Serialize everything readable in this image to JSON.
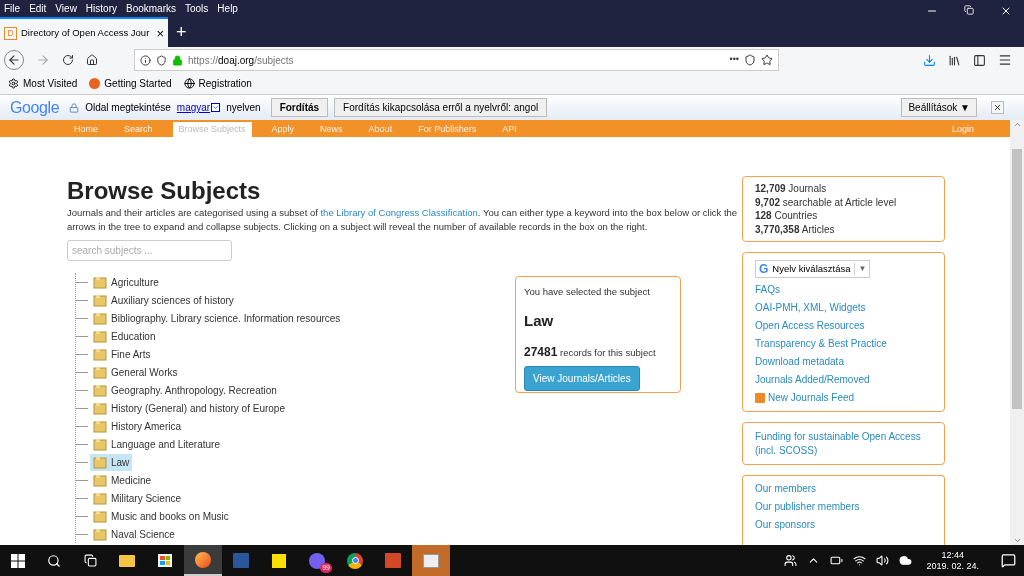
{
  "menu_bar": [
    "File",
    "Edit",
    "View",
    "History",
    "Bookmarks",
    "Tools",
    "Help"
  ],
  "tab": {
    "favicon": "D",
    "title": "Directory of Open Access Jour",
    "close": "×",
    "new_tab": "+"
  },
  "address_bar": {
    "scheme": "https://",
    "domain": "doaj.org",
    "path": "/subjects",
    "more": "•••"
  },
  "bookmarks": [
    "Most Visited",
    "Getting Started",
    "Registration"
  ],
  "translate_bar": {
    "logo": "Google",
    "label": "Oldal megtekintése",
    "language": "magyar",
    "suffix": "nyelven",
    "translate_button": "Fordítás",
    "disable_button": "Fordítás kikapcsolása erről a nyelvről: angol",
    "settings_button": "Beállítások ▼"
  },
  "site_nav": [
    {
      "label": "Home",
      "selected": false
    },
    {
      "label": "Search",
      "selected": false
    },
    {
      "label": "Browse Subjects",
      "selected": true
    },
    {
      "label": "Apply",
      "selected": false
    },
    {
      "label": "News",
      "selected": false
    },
    {
      "label": "About",
      "selected": false
    },
    {
      "label": "For Publishers",
      "selected": false
    },
    {
      "label": "API",
      "selected": false
    },
    {
      "label": "Login",
      "selected": false
    }
  ],
  "page": {
    "title": "Browse Subjects",
    "intro_before": "Journals and their articles are categorised using a subset of ",
    "intro_link": "the Library of Congress Classification",
    "intro_after": ". You can either type a keyword into the box below or click the arrows in the tree to expand and collapse subjects. Clicking on a subject will reveal the number of available records in the box on the right.",
    "search_placeholder": "search subjects ..."
  },
  "subjects": [
    {
      "label": "Agriculture",
      "selected": false
    },
    {
      "label": "Auxiliary sciences of history",
      "selected": false
    },
    {
      "label": "Bibliography. Library science. Information resources",
      "selected": false
    },
    {
      "label": "Education",
      "selected": false
    },
    {
      "label": "Fine Arts",
      "selected": false
    },
    {
      "label": "General Works",
      "selected": false
    },
    {
      "label": "Geography. Anthropology. Recreation",
      "selected": false
    },
    {
      "label": "History (General) and history of Europe",
      "selected": false
    },
    {
      "label": "History America",
      "selected": false
    },
    {
      "label": "Language and Literature",
      "selected": false
    },
    {
      "label": "Law",
      "selected": true
    },
    {
      "label": "Medicine",
      "selected": false
    },
    {
      "label": "Military Science",
      "selected": false
    },
    {
      "label": "Music and books on Music",
      "selected": false
    },
    {
      "label": "Naval Science",
      "selected": false
    }
  ],
  "selection_box": {
    "intro": "You have selected the subject",
    "subject": "Law",
    "count": "27481",
    "count_suffix": "records for this subject",
    "button": "View Journals/Articles"
  },
  "stats": [
    "**12,709** Journals",
    "**9,702** searchable at Article level",
    "**128** Countries",
    "**3,770,358** Articles"
  ],
  "language_select": {
    "logo": "G",
    "label": "Nyelv kiválasztása",
    "arrow": "▼"
  },
  "links": [
    {
      "label": "FAQs",
      "kind": "link"
    },
    {
      "label": "OAI-PMH, XML, Widgets",
      "kind": "link"
    },
    {
      "label": "Open Access Resources",
      "kind": "link"
    },
    {
      "label": "Transparency & Best Practice",
      "kind": "link"
    },
    {
      "label": "Download metadata",
      "kind": "link"
    },
    {
      "label": "Journals Added/Removed",
      "kind": "link"
    },
    {
      "label": "New Journals Feed",
      "kind": "feed"
    }
  ],
  "funding_link": "Funding for sustainable Open Access (incl. SCOSS)",
  "member_links": [
    "Our members",
    "Our publisher members",
    "Our sponsors"
  ],
  "taskbar": {
    "badge": "99",
    "time": "12:44",
    "date": "2019. 02. 24."
  }
}
